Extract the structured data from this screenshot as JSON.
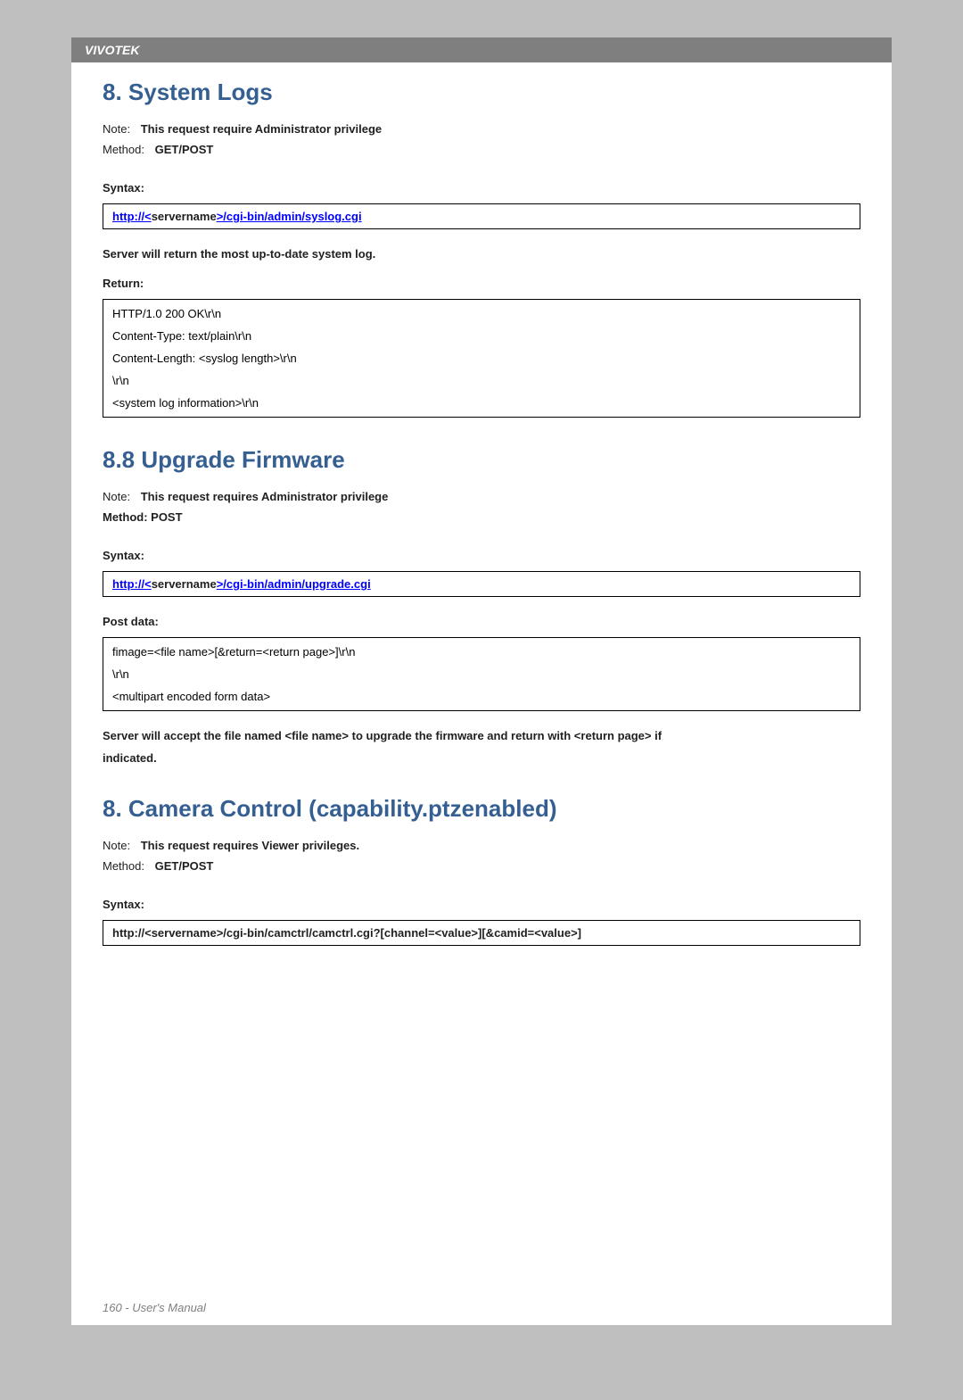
{
  "header": {
    "brand": "VIVOTEK"
  },
  "section1": {
    "title": "8. System Logs",
    "noteLabel": "Note:",
    "noteValue": "This request require Administrator privilege",
    "methodLabel": "Method:",
    "methodValue": "GET/POST",
    "syntaxLabel": "Syntax:",
    "syntax": {
      "prefix": "http://<",
      "servername": "servername",
      "suffix": ">/cgi-bin/admin/syslog.cgi"
    },
    "returnPara": "Server will return the most up-to-date system log.",
    "returnLabel": "Return:",
    "returnLines": [
      "HTTP/1.0 200 OK\\r\\n",
      "Content-Type: text/plain\\r\\n",
      "Content-Length: <syslog length>\\r\\n",
      "\\r\\n",
      "<system log information>\\r\\n"
    ]
  },
  "section2": {
    "title": "8.8 Upgrade Firmware",
    "noteLabel": "Note:",
    "noteValue": "This request requires Administrator privilege",
    "methodText": "Method: POST",
    "syntaxLabel": "Syntax:",
    "syntax": {
      "prefix": "http://<",
      "servername": "servername",
      "suffix": ">/cgi-bin/admin/upgrade.cgi"
    },
    "postDataLabel": "Post data:",
    "postDataLines": [
      "fimage=<file name>[&return=<return page>]\\r\\n",
      "\\r\\n",
      "<multipart encoded form data>"
    ],
    "returnPara1": "Server will accept the file named <file name> to upgrade the firmware and return with <return page> if",
    "returnPara2": "indicated."
  },
  "section3": {
    "title": "8. Camera Control (capability.ptzenabled)",
    "noteLabel": "Note:",
    "noteValue": "This request requires Viewer privileges.",
    "methodLabel": "Method:",
    "methodValue": "GET/POST",
    "syntaxLabel": "Syntax:",
    "syntax": {
      "prefix": "http://<",
      "servername": "servername",
      "middle": ">/cgi-bin/camctrl/camctrl.cgi?[channel=<value>][&camid=<value>]"
    }
  },
  "footer": {
    "text": "160 - User's Manual"
  }
}
